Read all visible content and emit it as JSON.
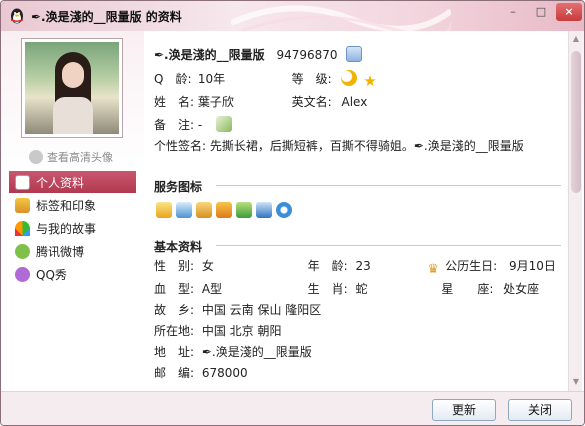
{
  "window": {
    "title": "✒.涣是淺的__限量版 的资料",
    "minimize": "–",
    "maximize": "□",
    "close": "×"
  },
  "left": {
    "hd_avatar_link": "查看高清头像",
    "nav": [
      {
        "label": "个人资料",
        "icon": "profile-card-icon",
        "active": true
      },
      {
        "label": "标签和印象",
        "icon": "tag-icon",
        "active": false
      },
      {
        "label": "与我的故事",
        "icon": "rainbow-icon",
        "active": false
      },
      {
        "label": "腾讯微博",
        "icon": "weibo-icon",
        "active": false
      },
      {
        "label": "QQ秀",
        "icon": "qq-show-icon",
        "active": false
      }
    ]
  },
  "profile": {
    "nickname": "✒.涣是淺的__限量版",
    "qq_number": "94796870",
    "age_label": "Q　龄:",
    "age_value": "10年",
    "level_label": "等　级:",
    "name_label": "姓　名:",
    "name_value": "葉子欣",
    "english_label": "英文名:",
    "english_value": "Alex",
    "remark_label": "备　注:",
    "remark_value": "-",
    "signature_label": "个性签名:",
    "signature_value": "先撕长裙，后撕短裤，百撕不得骑姐。✒.涣是淺的__限量版"
  },
  "service": {
    "title": "服务图标"
  },
  "basic": {
    "title": "基本资料",
    "gender_label": "性　别:",
    "gender_value": "女",
    "age2_label": "年　龄:",
    "age2_value": "23",
    "lunar_label": "公历生日:",
    "lunar_value": "9月10日",
    "blood_label": "血　型:",
    "blood_value": "A型",
    "zodiac_label": "生　肖:",
    "zodiac_value": "蛇",
    "constellation_label": "星　　座:",
    "constellation_value": "处女座",
    "hometown_label": "故　乡:",
    "hometown_value": "中国 云南 保山 隆阳区",
    "location_label": "所在地:",
    "location_value": "中国 北京 朝阳",
    "address_label": "地　址:",
    "address_value": "✒.涣是淺的__限量版",
    "postcode_label": "邮　编:",
    "postcode_value": "678000"
  },
  "footer": {
    "refresh": "更新",
    "close": "关闭"
  }
}
